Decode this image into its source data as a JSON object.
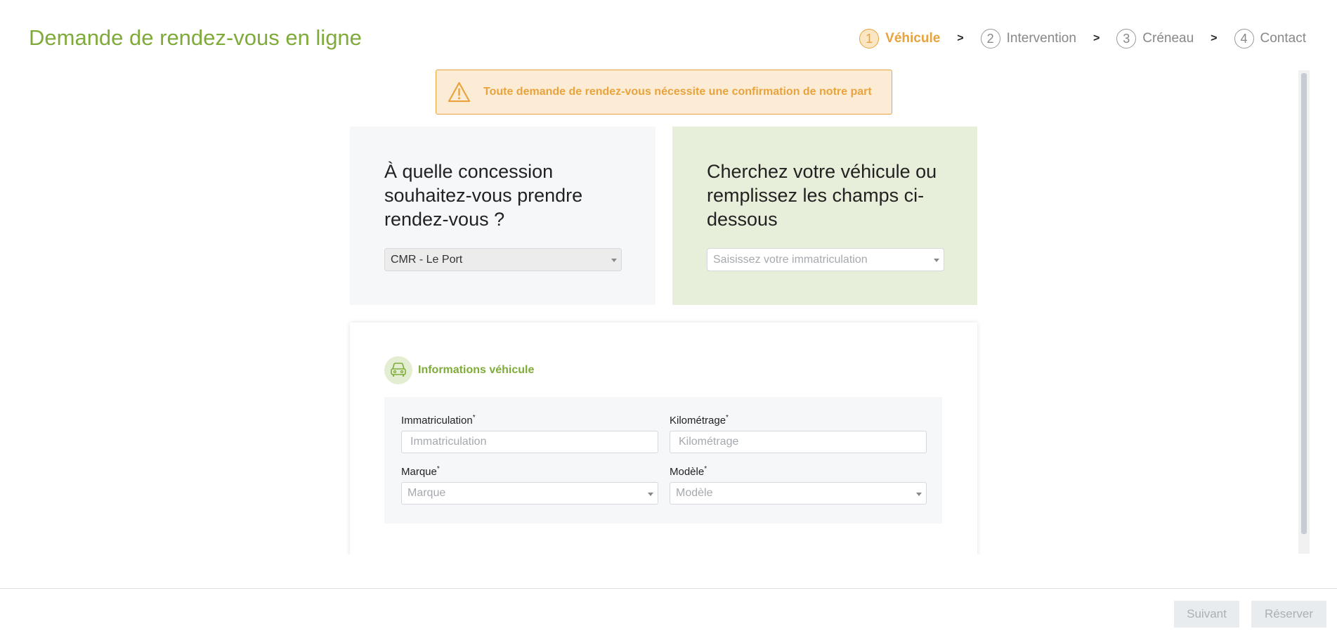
{
  "header": {
    "title": "Demande de rendez-vous en ligne",
    "steps": [
      {
        "num": "1",
        "label": "Véhicule"
      },
      {
        "num": "2",
        "label": "Intervention"
      },
      {
        "num": "3",
        "label": "Créneau"
      },
      {
        "num": "4",
        "label": "Contact"
      }
    ],
    "separator": ">",
    "active_step": 1
  },
  "alert": {
    "icon": "warning-icon",
    "text": "Toute demande de rendez-vous nécessite une confirmation de notre part"
  },
  "dealership": {
    "heading": "À quelle concession souhaitez-vous prendre rendez-vous ?",
    "selected": "CMR - Le Port"
  },
  "vehicle_search": {
    "heading": "Cherchez votre véhicule ou remplissez les champs ci-dessous",
    "placeholder": "Saisissez votre immatriculation"
  },
  "vehicle_info": {
    "icon": "car-icon",
    "title": "Informations véhicule",
    "required_mark": "*",
    "fields": {
      "immatriculation": {
        "label": "Immatriculation",
        "placeholder": "Immatriculation"
      },
      "kilometrage": {
        "label": "Kilométrage",
        "placeholder": "Kilométrage"
      },
      "marque": {
        "label": "Marque",
        "placeholder": "Marque"
      },
      "modele": {
        "label": "Modèle",
        "placeholder": "Modèle"
      }
    }
  },
  "footer": {
    "next_label": "Suivant",
    "book_label": "Réserver"
  },
  "colors": {
    "brand_green": "#7fab3a",
    "accent_orange": "#e8a33c",
    "alert_bg": "#fcecd6",
    "green_panel": "#e7eed9"
  }
}
